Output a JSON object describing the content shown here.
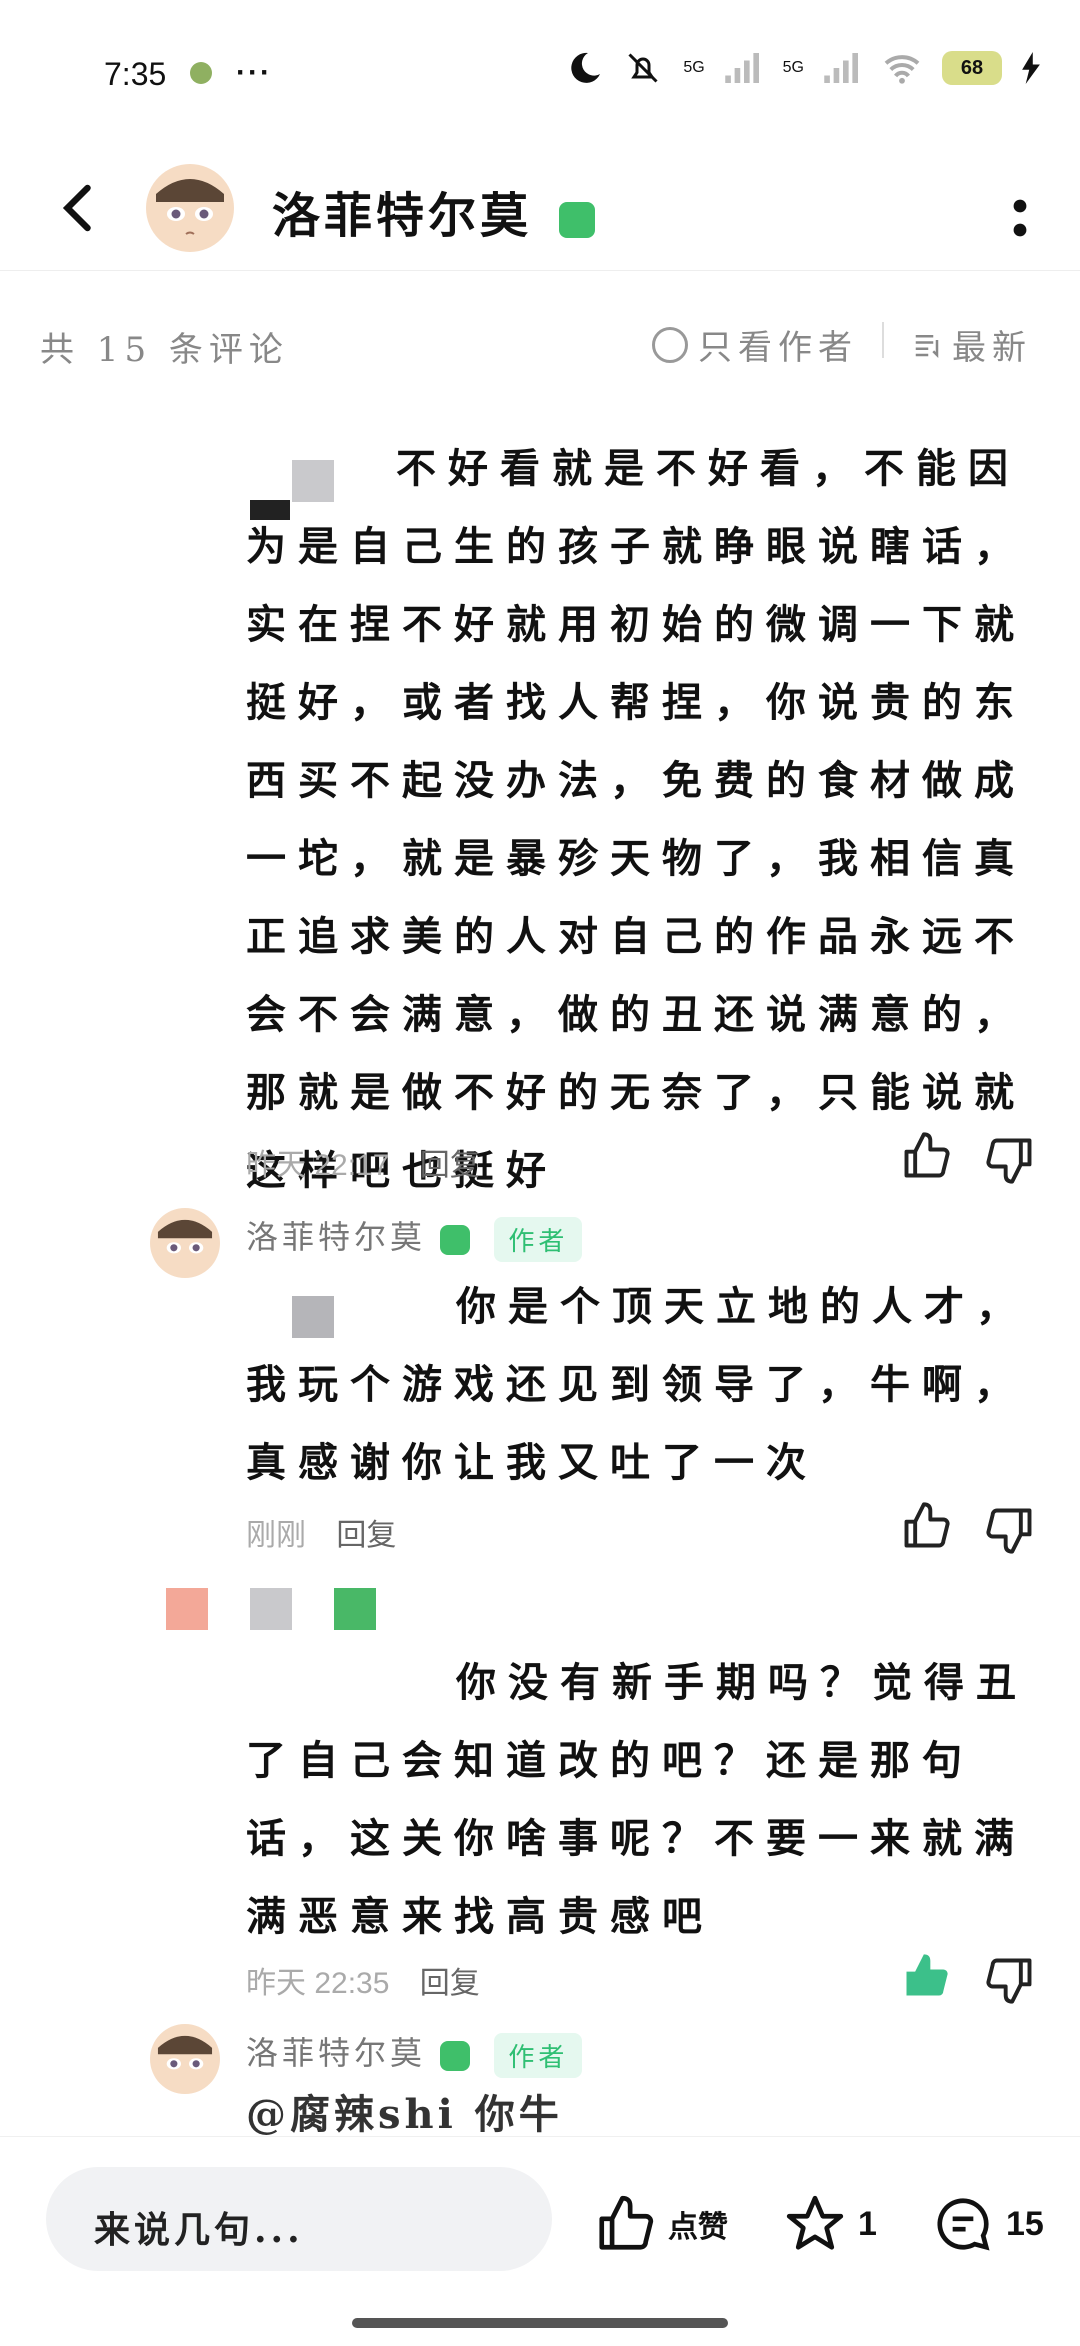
{
  "status_bar": {
    "time": "7:35",
    "dots": "···",
    "battery": "68",
    "signal1": "5G",
    "signal2": "5G"
  },
  "header": {
    "name": "洛菲特尔莫"
  },
  "subbar": {
    "comment_count": "共 15 条评论",
    "only_author": "只看作者",
    "latest": "最新"
  },
  "comments": [
    {
      "text": "不好看就是不好看，不能因为是自己生的孩子就睁眼说瞎话，实在捏不好就用初始的微调一下就挺好，或者找人帮捏，你说贵的东西买不起没办法，免费的食材做成一坨，就是暴殄天物了，我相信真正追求美的人对自己的作品永远不会不会满意，做的丑还说满意的，那就是做不好的无奈了，只能说就这样吧也挺好",
      "time": "昨天 22:17",
      "reply": "回复"
    },
    {
      "username": "洛菲特尔莫",
      "author_tag": "作者",
      "text": "你是个顶天立地的人才，我玩个游戏还见到领导了，牛啊，真感谢你让我又吐了一次",
      "time": "刚刚",
      "reply": "回复"
    },
    {
      "text": "你没有新手期吗？觉得丑了自己会知道改的吧？还是那句话，这关你啥事呢？不要一来就满满恶意来找高贵感吧",
      "time": "昨天 22:35",
      "reply": "回复"
    },
    {
      "username": "洛菲特尔莫",
      "author_tag": "作者",
      "text": "@腐辣shi  你牛"
    }
  ],
  "bottom_bar": {
    "input_placeholder": "来说几句...",
    "like_label": "点赞",
    "star_count": "1",
    "comment_count": "15"
  },
  "colors": {
    "accent_green": "#3fbf6a",
    "liked_thumb": "#3cc08a"
  }
}
